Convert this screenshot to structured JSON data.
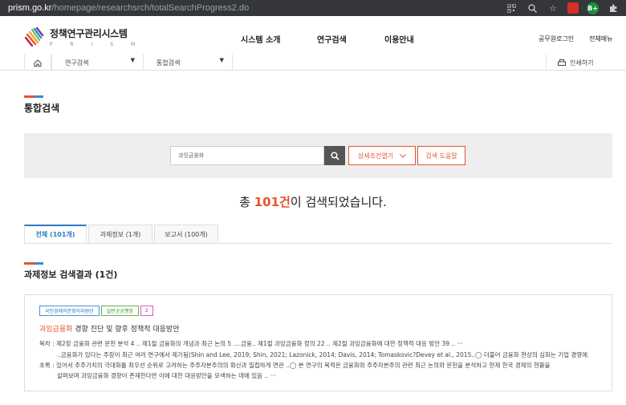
{
  "browser": {
    "host": "prism.go.kr",
    "path": "/homepage/researchsrch/totalSearchProgress2.do",
    "ext_label": "B+"
  },
  "header": {
    "logo_title": "정책연구관리시스템",
    "logo_sub": "P R I S M",
    "nav": [
      "시스템 소개",
      "연구검색",
      "이용안내"
    ],
    "util": [
      "공무원로그인",
      "전체메뉴"
    ]
  },
  "breadcrumb": {
    "select1": "연구검색",
    "select2": "통합검색",
    "print": "인쇄하기"
  },
  "page_title": "통합검색",
  "search": {
    "value": "과잉금융화",
    "detail_label": "상세조건열기",
    "help_label": "검색 도움말"
  },
  "result": {
    "prefix": "총 ",
    "count": "101건",
    "suffix": "이 검색되었습니다."
  },
  "tabs": [
    {
      "label": "전체 (101개)"
    },
    {
      "label": "과제정보 (1개)"
    },
    {
      "label": "보고서 (100개)"
    }
  ],
  "section_title": "과제정보 검색결과 (1건)",
  "card": {
    "badges": [
      "국민경제자문회의지원단",
      "일반공공행정",
      "2"
    ],
    "title_hl": "과잉금융화",
    "title_rest": " 경향 진단 및 향후 정책적 대응방안",
    "lines": [
      "목차 : 제2장 금융화 관련 문헌 분석 4 .. 제1절 금융화의 개념과 최근 논의 5 ....금융.. 제1절 과잉금융화 정의 22 .. 제2절 과잉금융화에 대한 정책적 대응 방안 39 .. ···",
      "..금융화가 있다는 주장이 최근 여러 연구에서 제기됨(Shin and Lee, 2019; Shin, 2021; Lazonick, 2014; Davis, 2014; Tomaskovic?Devey et al., 2015..◯ 더불어 금융화 현상의 심화는 기업 경영에",
      "초록 : 있어서 주주가치의 극대화를 최우선 순위로 고려하는 주주자본주의의 확산과 밀접하게 연관 ..◯ 본 연구의 목적은 금융화와 주주자본주의 관련 최근 논의와 문헌을 분석하고 현재 한국 경제의 현황을",
      "살펴보며 과잉금융화 경향이 존재한다면 이에 대한 대응방안을 모색하는 데에 있음 .. ···"
    ]
  },
  "colors": {
    "accent": "#e8532c",
    "blue": "#2e7bc4"
  }
}
